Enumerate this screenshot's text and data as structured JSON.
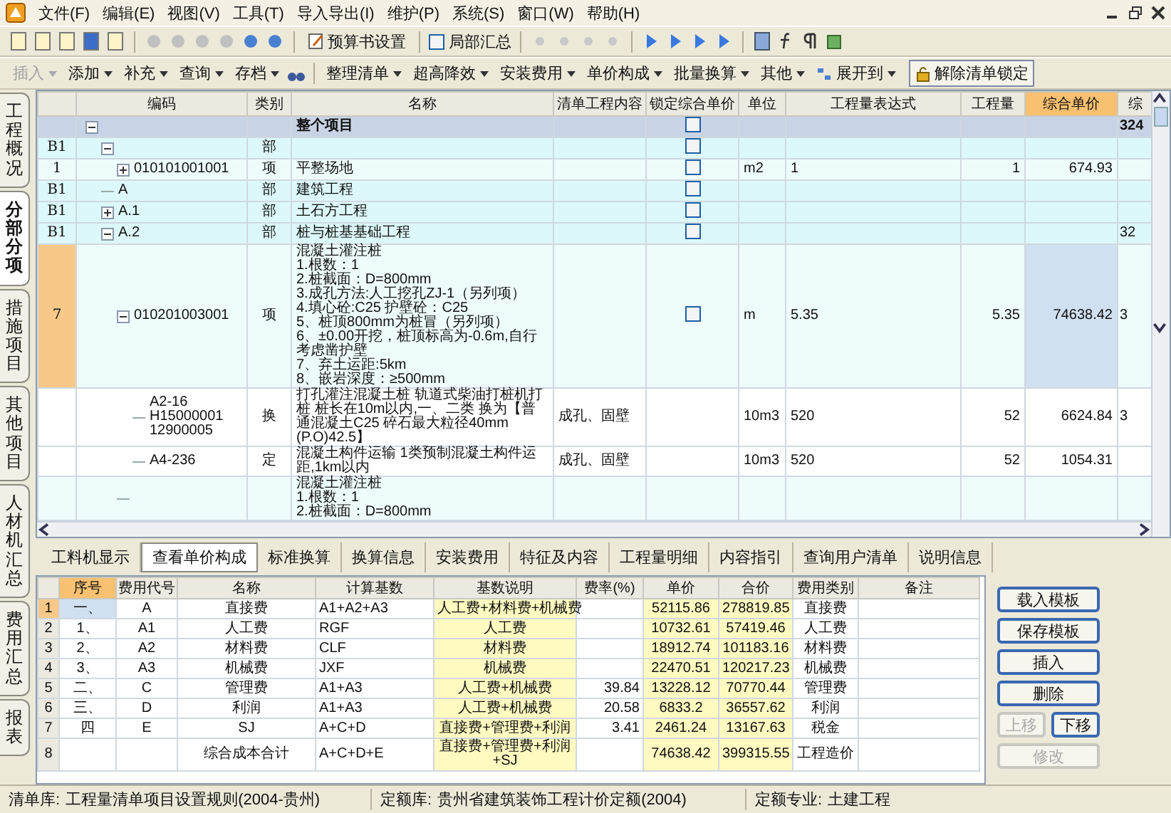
{
  "menu": [
    "文件(F)",
    "编辑(E)",
    "视图(V)",
    "工具(T)",
    "导入导出(I)",
    "维护(P)",
    "系统(S)",
    "窗口(W)",
    "帮助(H)"
  ],
  "toolbar": {
    "budget_settings": "预算书设置",
    "partial_summary": {
      "label": "局部汇总",
      "checked": false
    }
  },
  "toolbar2": {
    "group1": [
      {
        "label": "插入",
        "disabled": true
      },
      {
        "label": "添加",
        "disabled": false
      },
      {
        "label": "补充",
        "disabled": false
      },
      {
        "label": "查询",
        "disabled": false
      },
      {
        "label": "存档",
        "disabled": false
      }
    ],
    "group2": [
      {
        "label": "整理清单",
        "disabled": false
      },
      {
        "label": "超高降效",
        "disabled": false
      },
      {
        "label": "安装费用",
        "disabled": false
      },
      {
        "label": "单价构成",
        "disabled": false
      },
      {
        "label": "批量换算",
        "disabled": false
      },
      {
        "label": "其他",
        "disabled": false
      },
      {
        "label": "展开到",
        "disabled": false
      }
    ],
    "unlock_button": "解除清单锁定"
  },
  "side_tabs": [
    {
      "label": "工程概况",
      "selected": false
    },
    {
      "label": "分部分项",
      "selected": true
    },
    {
      "label": "措施项目",
      "selected": false
    },
    {
      "label": "其他项目",
      "selected": false
    },
    {
      "label": "人材机汇总",
      "selected": false
    },
    {
      "label": "费用汇总",
      "selected": false
    },
    {
      "label": "报表",
      "selected": false
    }
  ],
  "grid": {
    "columns": [
      {
        "label": "编码",
        "selected": false
      },
      {
        "label": "类别",
        "selected": false
      },
      {
        "label": "名称",
        "selected": false
      },
      {
        "label": "清单工程内容",
        "selected": false
      },
      {
        "label": "锁定综合单价",
        "selected": false
      },
      {
        "label": "单位",
        "selected": false
      },
      {
        "label": "工程量表达式",
        "selected": false
      },
      {
        "label": "工程量",
        "selected": false
      },
      {
        "label": "综合单价",
        "selected": true
      },
      {
        "label": "综",
        "selected": false
      }
    ],
    "rows": [
      {
        "kind": "total",
        "name": "整个项目",
        "expanded": true,
        "locked": false,
        "col_11": "324",
        "selected": false,
        "children": [
          {
            "kind": "section",
            "num": "B1",
            "type": "部",
            "expanded": true,
            "locked": false,
            "selected": false,
            "children": [
              {
                "kind": "item",
                "num": "1",
                "code": "010101001001",
                "type": "项",
                "name": "平整场地",
                "expanded": false,
                "locked": false,
                "unit": "m2",
                "expr": "1",
                "qty": "1",
                "price": "674.93",
                "selected": false
              }
            ]
          },
          {
            "kind": "section",
            "num": "B1",
            "code": "A",
            "type": "部",
            "name": "建筑工程",
            "locked": false,
            "selected": false
          },
          {
            "kind": "section",
            "num": "B1",
            "code": "A.1",
            "type": "部",
            "name": "土石方工程",
            "expanded": false,
            "locked": false,
            "selected": false
          },
          {
            "kind": "section",
            "num": "B1",
            "code": "A.2",
            "type": "部",
            "name": "桩与桩基基础工程",
            "expanded": true,
            "locked": false,
            "col_11": "32",
            "selected": false,
            "children": [
              {
                "kind": "item",
                "num": "7",
                "code": "010201003001",
                "type": "项",
                "name": "混凝土灌注桩\n1.根数：1\n2.桩截面：D=800mm\n3.成孔方法:人工挖孔ZJ-1（另列项）\n4.填心砼:C25  护壁砼：C25\n5、桩顶800mm为桩冒（另列项）\n6、±0.00开挖，桩顶标高为-0.6m,自行考虑凿护壁\n7、弃土运距:5km\n8、嵌岩深度：≥500mm",
                "expanded": true,
                "locked": false,
                "unit": "m",
                "expr": "5.35",
                "qty": "5.35",
                "price": "74638.42",
                "col_11": "3",
                "selected": true,
                "children": [
                  {
                    "kind": "quota",
                    "code": "A2-16 H15000001 12900005",
                    "type": "换",
                    "name": "打孔灌注混凝土桩 轨道式柴油打桩机打桩 桩长在10m以内,一、二类 换为【普通混凝土C25 碎石最大粒径40mm (P.O)42.5】",
                    "content": "成孔、固壁",
                    "unit": "10m3",
                    "expr": "520",
                    "qty": "52",
                    "price": "6624.84",
                    "col_11": "3",
                    "selected": false
                  },
                  {
                    "kind": "quota",
                    "code": "A4-236",
                    "type": "定",
                    "name": "混凝土构件运输 1类预制混凝土构件运距,1km以内",
                    "content": "成孔、固壁",
                    "unit": "10m3",
                    "expr": "520",
                    "qty": "52",
                    "price": "1054.31",
                    "selected": false
                  }
                ]
              },
              {
                "kind": "item",
                "name": "混凝土灌注桩\n1.根数：1\n2.桩截面：D=800mm",
                "selected": false
              }
            ]
          }
        ]
      }
    ]
  },
  "detail_tabs": [
    {
      "label": "工料机显示",
      "selected": false
    },
    {
      "label": "查看单价构成",
      "selected": true
    },
    {
      "label": "标准换算",
      "selected": false
    },
    {
      "label": "换算信息",
      "selected": false
    },
    {
      "label": "安装费用",
      "selected": false
    },
    {
      "label": "特征及内容",
      "selected": false
    },
    {
      "label": "工程量明细",
      "selected": false
    },
    {
      "label": "内容指引",
      "selected": false
    },
    {
      "label": "查询用户清单",
      "selected": false
    },
    {
      "label": "说明信息",
      "selected": false
    }
  ],
  "cost_table": {
    "columns": [
      {
        "label": "序号",
        "selected": true
      },
      {
        "label": "费用代号",
        "selected": false
      },
      {
        "label": "名称",
        "selected": false
      },
      {
        "label": "计算基数",
        "selected": false
      },
      {
        "label": "基数说明",
        "selected": false
      },
      {
        "label": "费率(%)",
        "selected": false
      },
      {
        "label": "单价",
        "selected": false
      },
      {
        "label": "合价",
        "selected": false
      },
      {
        "label": "费用类别",
        "selected": false
      },
      {
        "label": "备注",
        "selected": false
      }
    ],
    "rows": [
      {
        "num": "1",
        "seq": "一、",
        "code": "A",
        "name": "直接费",
        "base": "A1+A2+A3",
        "desc": "人工费+材料费+机械费",
        "unit_price": "52115.86",
        "total": "278819.85",
        "category": "直接费",
        "selected": true
      },
      {
        "num": "2",
        "seq": "1、",
        "code": "A1",
        "name": "人工费",
        "base": "RGF",
        "desc": "人工费",
        "unit_price": "10732.61",
        "total": "57419.46",
        "category": "人工费",
        "selected": false
      },
      {
        "num": "3",
        "seq": "2、",
        "code": "A2",
        "name": "材料费",
        "base": "CLF",
        "desc": "材料费",
        "unit_price": "18912.74",
        "total": "101183.16",
        "category": "材料费",
        "selected": false
      },
      {
        "num": "4",
        "seq": "3、",
        "code": "A3",
        "name": "机械费",
        "base": "JXF",
        "desc": "机械费",
        "unit_price": "22470.51",
        "total": "120217.23",
        "category": "机械费",
        "selected": false
      },
      {
        "num": "5",
        "seq": "二、",
        "code": "C",
        "name": "管理费",
        "base": "A1+A3",
        "desc": "人工费+机械费",
        "rate": "39.84",
        "unit_price": "13228.12",
        "total": "70770.44",
        "category": "管理费",
        "selected": false
      },
      {
        "num": "6",
        "seq": "三、",
        "code": "D",
        "name": "利润",
        "base": "A1+A3",
        "desc": "人工费+机械费",
        "rate": "20.58",
        "unit_price": "6833.2",
        "total": "36557.62",
        "category": "利润",
        "selected": false
      },
      {
        "num": "7",
        "seq": "四",
        "code": "E",
        "name": "SJ",
        "base": "A+C+D",
        "desc": "直接费+管理费+利润",
        "rate": "3.41",
        "unit_price": "2461.24",
        "total": "13167.63",
        "category": "税金",
        "selected": false
      },
      {
        "num": "8",
        "name": "综合成本合计",
        "base": "A+C+D+E",
        "desc": "直接费+管理费+利润+SJ",
        "unit_price": "74638.42",
        "total": "399315.55",
        "category": "工程造价",
        "selected": false
      }
    ]
  },
  "side_buttons": [
    {
      "label": "载入模板",
      "kind": "wide",
      "disabled": false
    },
    {
      "label": "保存模板",
      "kind": "wide",
      "disabled": false
    },
    {
      "label": "插入",
      "kind": "wide",
      "disabled": false
    },
    {
      "label": "删除",
      "kind": "wide",
      "disabled": false
    },
    {
      "label": "上移",
      "kind": "half",
      "disabled": true
    },
    {
      "label": "下移",
      "kind": "half",
      "disabled": false
    },
    {
      "label": "修改",
      "kind": "wide",
      "disabled": true
    }
  ],
  "status_bar": [
    {
      "label": "清单库:",
      "value": "工程量清单项目设置规则(2004-贵州)"
    },
    {
      "label": "定额库:",
      "value": "贵州省建筑装饰工程计价定额(2004)"
    },
    {
      "label": "定额专业:",
      "value": "土建工程"
    }
  ]
}
